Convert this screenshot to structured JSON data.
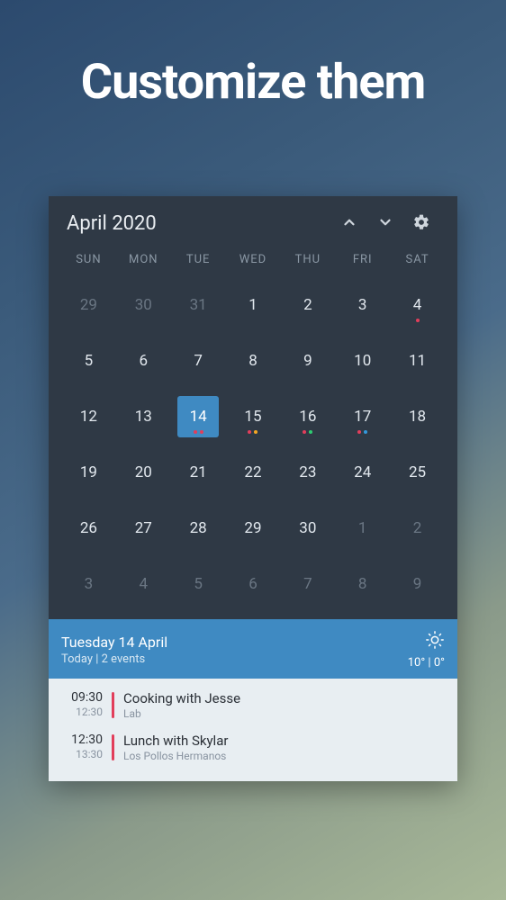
{
  "heading": "Customize them",
  "calendar": {
    "title": "April 2020",
    "dow": [
      "SUN",
      "MON",
      "TUE",
      "WED",
      "THU",
      "FRI",
      "SAT"
    ],
    "days": [
      {
        "n": "29",
        "other": true
      },
      {
        "n": "30",
        "other": true
      },
      {
        "n": "31",
        "other": true
      },
      {
        "n": "1"
      },
      {
        "n": "2"
      },
      {
        "n": "3"
      },
      {
        "n": "4",
        "dots": [
          "#e23e5b"
        ]
      },
      {
        "n": "5"
      },
      {
        "n": "6"
      },
      {
        "n": "7"
      },
      {
        "n": "8"
      },
      {
        "n": "9"
      },
      {
        "n": "10"
      },
      {
        "n": "11"
      },
      {
        "n": "12"
      },
      {
        "n": "13"
      },
      {
        "n": "14",
        "selected": true,
        "dots": [
          "#e23e5b",
          "#e23e5b"
        ]
      },
      {
        "n": "15",
        "dots": [
          "#e23e5b",
          "#f5a623"
        ]
      },
      {
        "n": "16",
        "dots": [
          "#e23e5b",
          "#2ecc71"
        ]
      },
      {
        "n": "17",
        "dots": [
          "#e23e5b",
          "#3498db"
        ]
      },
      {
        "n": "18"
      },
      {
        "n": "19"
      },
      {
        "n": "20"
      },
      {
        "n": "21"
      },
      {
        "n": "22"
      },
      {
        "n": "23"
      },
      {
        "n": "24"
      },
      {
        "n": "25"
      },
      {
        "n": "26"
      },
      {
        "n": "27"
      },
      {
        "n": "28"
      },
      {
        "n": "29"
      },
      {
        "n": "30"
      },
      {
        "n": "1",
        "other": true
      },
      {
        "n": "2",
        "other": true
      },
      {
        "n": "3",
        "other": true
      },
      {
        "n": "4",
        "other": true
      },
      {
        "n": "5",
        "other": true
      },
      {
        "n": "6",
        "other": true
      },
      {
        "n": "7",
        "other": true
      },
      {
        "n": "8",
        "other": true
      },
      {
        "n": "9",
        "other": true
      }
    ]
  },
  "agenda": {
    "date": "Tuesday 14 April",
    "subtitle": "Today | 2 events",
    "weather": {
      "temps": "10° | 0°"
    },
    "events": [
      {
        "start": "09:30",
        "end": "12:30",
        "title": "Cooking with Jesse",
        "location": "Lab",
        "color": "#e23e5b"
      },
      {
        "start": "12:30",
        "end": "13:30",
        "title": "Lunch with Skylar",
        "location": "Los Pollos Hermanos",
        "color": "#e23e5b"
      }
    ]
  }
}
